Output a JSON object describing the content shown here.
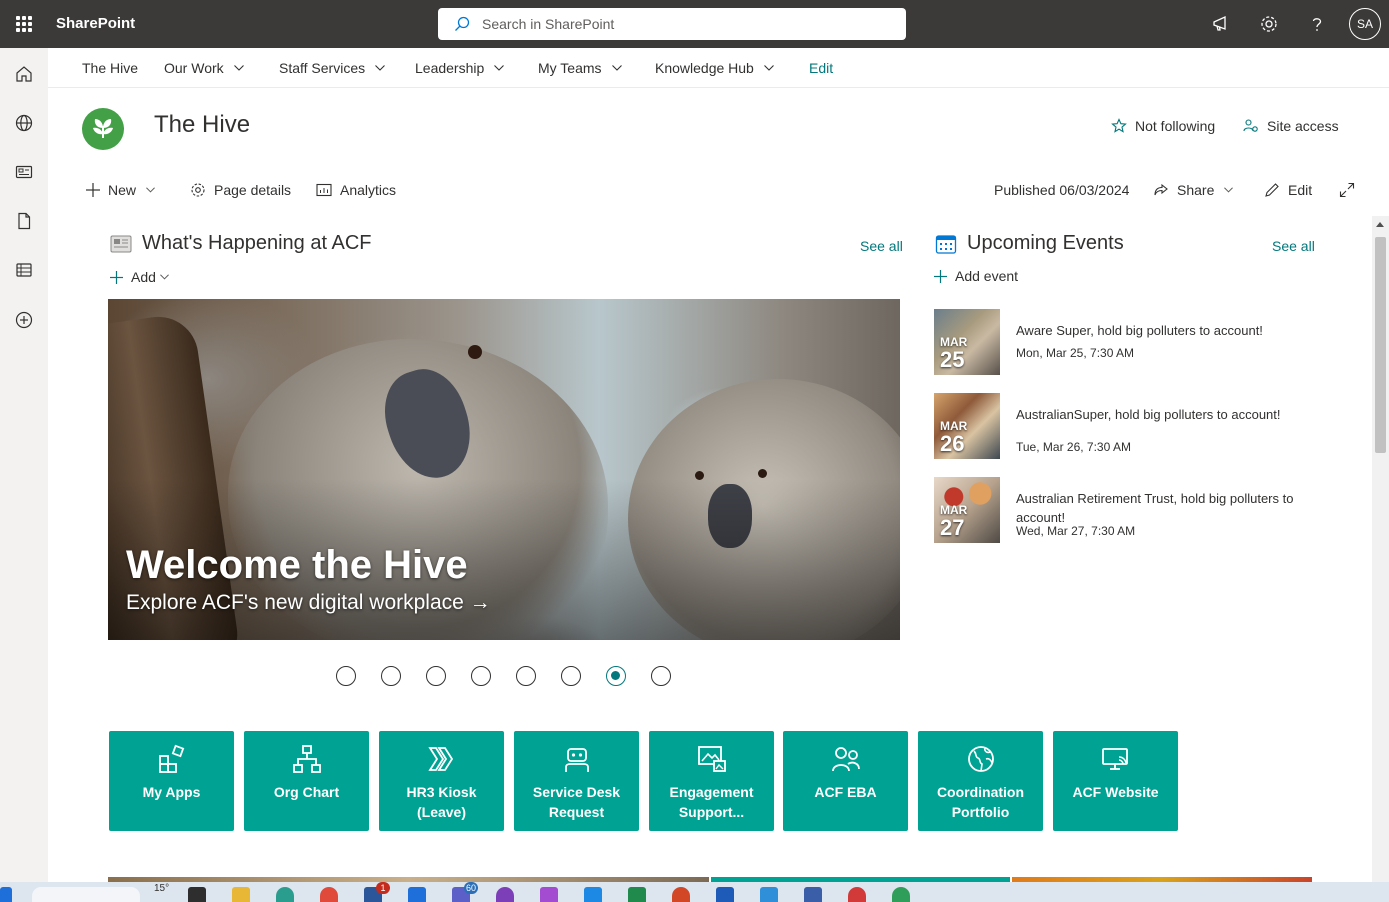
{
  "suite_bar": {
    "app_name": "SharePoint",
    "search_placeholder": "Search in SharePoint",
    "user_initials": "SA",
    "icons": [
      "app-launcher-icon",
      "search-icon",
      "megaphone-icon",
      "gear-icon",
      "help-icon"
    ]
  },
  "app_bar": {
    "icons": [
      "home-icon",
      "globe-icon",
      "news-icon",
      "file-icon",
      "list-icon",
      "add-circle-icon"
    ]
  },
  "top_nav": {
    "items": [
      {
        "label": "The Hive",
        "has_menu": false
      },
      {
        "label": "Our Work",
        "has_menu": true
      },
      {
        "label": "Staff Services",
        "has_menu": true
      },
      {
        "label": "Leadership",
        "has_menu": true
      },
      {
        "label": "My Teams",
        "has_menu": true
      },
      {
        "label": "Knowledge Hub",
        "has_menu": true
      }
    ],
    "edit_label": "Edit"
  },
  "site_header": {
    "title": "The Hive",
    "follow_label": "Not following",
    "site_access_label": "Site access"
  },
  "command_bar": {
    "new_label": "New",
    "page_details_label": "Page details",
    "analytics_label": "Analytics",
    "published_label": "Published 06/03/2024",
    "share_label": "Share",
    "edit_label": "Edit"
  },
  "news": {
    "title": "What's Happening at ACF",
    "see_all": "See all",
    "add_label": "Add",
    "hero": {
      "title": "Welcome the Hive",
      "subtitle": "Explore ACF's new digital workplace →"
    },
    "carousel": {
      "count": 8,
      "active_index": 6
    }
  },
  "events": {
    "title": "Upcoming Events",
    "see_all": "See all",
    "add_label": "Add event",
    "items": [
      {
        "month": "MAR",
        "day": "25",
        "title": "Aware Super, hold big polluters to account!",
        "time": "Mon, Mar 25, 7:30 AM"
      },
      {
        "month": "MAR",
        "day": "26",
        "title": "AustralianSuper, hold big polluters to account!",
        "time": "Tue, Mar 26, 7:30 AM"
      },
      {
        "month": "MAR",
        "day": "27",
        "title": "Australian Retirement Trust, hold big polluters to account!",
        "time": "Wed, Mar 27, 7:30 AM"
      }
    ]
  },
  "quick_links": {
    "tile_color": "#00a393",
    "items": [
      {
        "label": "My Apps",
        "icon": "apps-icon"
      },
      {
        "label": "Org Chart",
        "icon": "org-chart-icon"
      },
      {
        "label": "HR3 Kiosk (Leave)",
        "icon": "kiosk-icon"
      },
      {
        "label": "Service Desk Request",
        "icon": "bot-icon"
      },
      {
        "label": "Engagement Support...",
        "icon": "image-gallery-icon"
      },
      {
        "label": "ACF EBA",
        "icon": "people-icon"
      },
      {
        "label": "Coordination Portfolio",
        "icon": "earth-icon"
      },
      {
        "label": "ACF Website",
        "icon": "screen-cast-icon"
      }
    ]
  },
  "taskbar": {
    "temperature": "15°",
    "badges": [
      "1",
      "60"
    ]
  },
  "colors": {
    "accent": "#03787c",
    "suite_bar": "#3b3a39",
    "tile": "#00a393",
    "active_dot": "#03787c"
  }
}
